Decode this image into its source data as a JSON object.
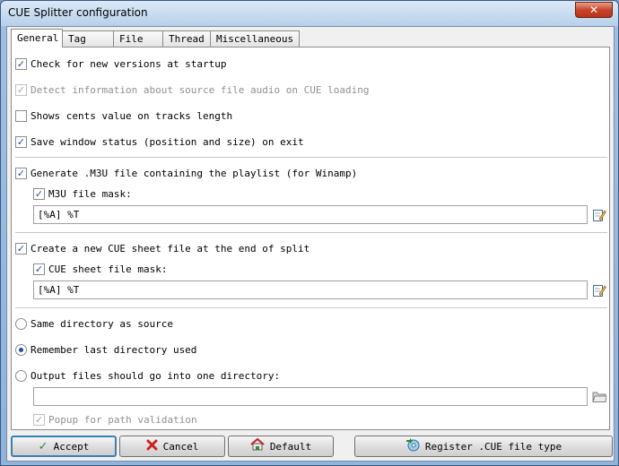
{
  "window": {
    "title": "CUE Splitter configuration",
    "close_glyph": "✕"
  },
  "tabs": [
    {
      "label": "General",
      "active": true
    },
    {
      "label": "Tag",
      "active": false
    },
    {
      "label": "File",
      "active": false
    },
    {
      "label": "Thread",
      "active": false
    },
    {
      "label": "Miscellaneous",
      "active": false
    }
  ],
  "general": {
    "check_versions": {
      "label": "Check for new versions at startup",
      "checked": true
    },
    "detect_info": {
      "label": "Detect information about source file audio on CUE loading",
      "checked": true,
      "disabled": true
    },
    "show_cents": {
      "label": "Shows cents value on tracks length",
      "checked": false
    },
    "save_window": {
      "label": "Save window status (position and size) on exit",
      "checked": true
    },
    "generate_m3u": {
      "label": "Generate .M3U file containing the playlist (for Winamp)",
      "checked": true
    },
    "m3u_mask": {
      "label": "M3U file mask:",
      "checked": true,
      "value": "[%A] %T"
    },
    "create_cue": {
      "label": "Create a new CUE sheet file at the end of split",
      "checked": true
    },
    "cue_mask": {
      "label": "CUE sheet file mask:",
      "checked": true,
      "value": "[%A] %T"
    },
    "radio_same_dir": {
      "label": "Same directory as source",
      "selected": false
    },
    "radio_remember": {
      "label": "Remember last directory used",
      "selected": true
    },
    "radio_output_dir": {
      "label": "Output files should go into one directory:",
      "selected": false
    },
    "output_dir_value": "",
    "popup_validation": {
      "label": "Popup for path validation",
      "checked": true,
      "disabled": true
    }
  },
  "buttons": {
    "accept": "Accept",
    "cancel": "Cancel",
    "default": "Default",
    "register": "Register .CUE file type"
  },
  "icons": {
    "check": "✓",
    "accept": "check-icon",
    "cancel": "cancel-x-icon",
    "default": "default-reset-icon",
    "register": "register-file-type-icon",
    "edit": "edit-pencil-icon",
    "folder": "folder-icon"
  },
  "colors": {
    "accept_green": "#2e8b2e",
    "cancel_red": "#cc2222",
    "checkmark_blue": "#1e4e9a"
  }
}
